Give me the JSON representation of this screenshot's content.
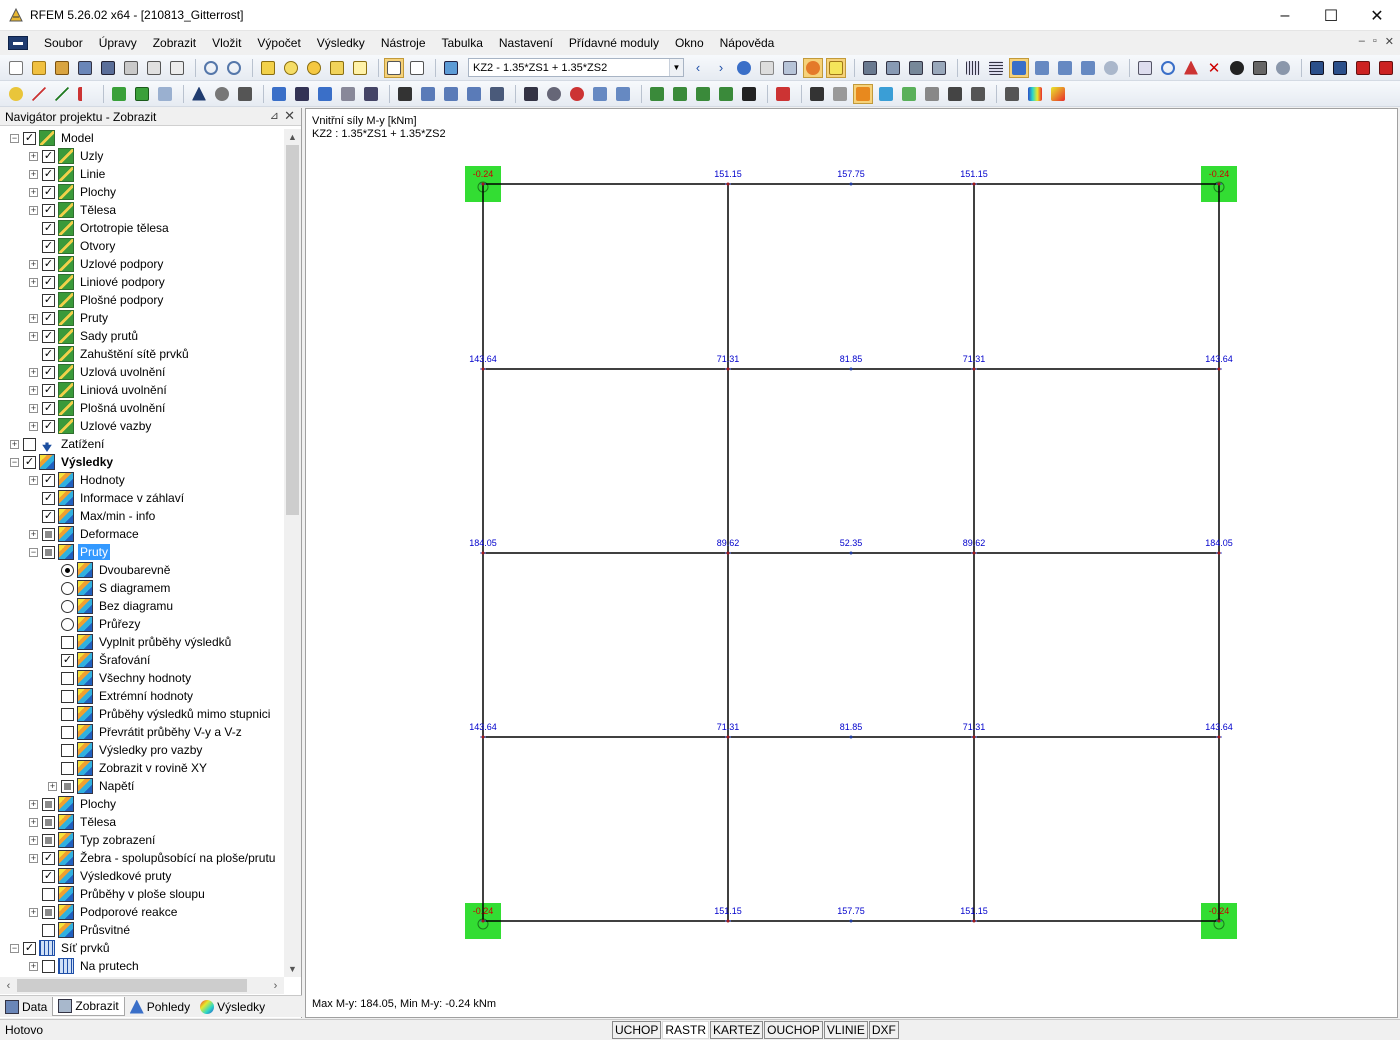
{
  "window": {
    "title": "RFEM 5.26.02 x64 - [210813_Gitterrost]",
    "controls": [
      "–",
      "☐",
      "✕"
    ]
  },
  "menu": {
    "items": [
      "Soubor",
      "Úpravy",
      "Zobrazit",
      "Vložit",
      "Výpočet",
      "Výsledky",
      "Nástroje",
      "Tabulka",
      "Nastavení",
      "Přídavné moduly",
      "Okno",
      "Nápověda"
    ],
    "mdi_controls": [
      "–",
      "▫",
      "✕"
    ]
  },
  "toolbar": {
    "load_case": "KZ2 - 1.35*ZS1 + 1.35*ZS2"
  },
  "navigator": {
    "title": "Navigátor projektu - Zobrazit",
    "pin": "⊿",
    "close": "✕",
    "tree": [
      {
        "label": "Model",
        "level": 0,
        "exp": "−",
        "check": "checked",
        "icon": "model"
      },
      {
        "label": "Uzly",
        "level": 1,
        "exp": "+",
        "check": "checked",
        "icon": "model"
      },
      {
        "label": "Linie",
        "level": 1,
        "exp": "+",
        "check": "checked",
        "icon": "model"
      },
      {
        "label": "Plochy",
        "level": 1,
        "exp": "+",
        "check": "checked",
        "icon": "model"
      },
      {
        "label": "Tělesa",
        "level": 1,
        "exp": "+",
        "check": "checked",
        "icon": "model"
      },
      {
        "label": "Ortotropie tělesa",
        "level": 1,
        "exp": "",
        "check": "checked",
        "icon": "model"
      },
      {
        "label": "Otvory",
        "level": 1,
        "exp": "",
        "check": "checked",
        "icon": "model"
      },
      {
        "label": "Uzlové podpory",
        "level": 1,
        "exp": "+",
        "check": "checked",
        "icon": "model"
      },
      {
        "label": "Liniové podpory",
        "level": 1,
        "exp": "+",
        "check": "checked",
        "icon": "model"
      },
      {
        "label": "Plošné podpory",
        "level": 1,
        "exp": "",
        "check": "checked",
        "icon": "model"
      },
      {
        "label": "Pruty",
        "level": 1,
        "exp": "+",
        "check": "checked",
        "icon": "model"
      },
      {
        "label": "Sady prutů",
        "level": 1,
        "exp": "+",
        "check": "checked",
        "icon": "model"
      },
      {
        "label": "Zahuštění sítě prvků",
        "level": 1,
        "exp": "",
        "check": "checked",
        "icon": "model"
      },
      {
        "label": "Uzlová uvolnění",
        "level": 1,
        "exp": "+",
        "check": "checked",
        "icon": "model"
      },
      {
        "label": "Liniová uvolnění",
        "level": 1,
        "exp": "+",
        "check": "checked",
        "icon": "model"
      },
      {
        "label": "Plošná uvolnění",
        "level": 1,
        "exp": "+",
        "check": "checked",
        "icon": "model"
      },
      {
        "label": "Uzlové vazby",
        "level": 1,
        "exp": "+",
        "check": "checked",
        "icon": "model"
      },
      {
        "label": "Zatížení",
        "level": 0,
        "exp": "+",
        "check": "unchecked",
        "icon": "load"
      },
      {
        "label": "Výsledky",
        "level": 0,
        "exp": "−",
        "check": "checked",
        "icon": "res",
        "bold": true
      },
      {
        "label": "Hodnoty",
        "level": 1,
        "exp": "+",
        "check": "checked",
        "icon": "res"
      },
      {
        "label": "Informace v záhlaví",
        "level": 1,
        "exp": "",
        "check": "checked",
        "icon": "res"
      },
      {
        "label": "Max/min - info",
        "level": 1,
        "exp": "",
        "check": "checked",
        "icon": "res"
      },
      {
        "label": "Deformace",
        "level": 1,
        "exp": "+",
        "check": "partial",
        "icon": "res"
      },
      {
        "label": "Pruty",
        "level": 1,
        "exp": "−",
        "check": "partial",
        "icon": "res",
        "selected": true
      },
      {
        "label": "Dvoubarevně",
        "level": 2,
        "exp": "",
        "check": "radio-on",
        "icon": "res"
      },
      {
        "label": "S diagramem",
        "level": 2,
        "exp": "",
        "check": "radio",
        "icon": "res"
      },
      {
        "label": "Bez diagramu",
        "level": 2,
        "exp": "",
        "check": "radio",
        "icon": "res"
      },
      {
        "label": "Průřezy",
        "level": 2,
        "exp": "",
        "check": "radio",
        "icon": "res"
      },
      {
        "label": "Vyplnit průběhy výsledků",
        "level": 2,
        "exp": "",
        "check": "unchecked",
        "icon": "res"
      },
      {
        "label": "Šrafování",
        "level": 2,
        "exp": "",
        "check": "checked",
        "icon": "res"
      },
      {
        "label": "Všechny hodnoty",
        "level": 2,
        "exp": "",
        "check": "unchecked",
        "icon": "res"
      },
      {
        "label": "Extrémní hodnoty",
        "level": 2,
        "exp": "",
        "check": "unchecked",
        "icon": "res"
      },
      {
        "label": "Průběhy výsledků mimo stupnici",
        "level": 2,
        "exp": "",
        "check": "unchecked",
        "icon": "res"
      },
      {
        "label": "Převrátit průběhy V-y a V-z",
        "level": 2,
        "exp": "",
        "check": "unchecked",
        "icon": "res"
      },
      {
        "label": "Výsledky pro vazby",
        "level": 2,
        "exp": "",
        "check": "unchecked",
        "icon": "res"
      },
      {
        "label": "Zobrazit v rovině XY",
        "level": 2,
        "exp": "",
        "check": "unchecked",
        "icon": "res"
      },
      {
        "label": "Napětí",
        "level": 2,
        "exp": "+",
        "check": "partial",
        "icon": "res"
      },
      {
        "label": "Plochy",
        "level": 1,
        "exp": "+",
        "check": "partial",
        "icon": "res"
      },
      {
        "label": "Tělesa",
        "level": 1,
        "exp": "+",
        "check": "partial",
        "icon": "res"
      },
      {
        "label": "Typ zobrazení",
        "level": 1,
        "exp": "+",
        "check": "partial",
        "icon": "res"
      },
      {
        "label": "Žebra - spolupůsobící na ploše/prutu",
        "level": 1,
        "exp": "+",
        "check": "checked",
        "icon": "res"
      },
      {
        "label": "Výsledkové pruty",
        "level": 1,
        "exp": "",
        "check": "checked",
        "icon": "res"
      },
      {
        "label": "Průběhy v ploše sloupu",
        "level": 1,
        "exp": "",
        "check": "unchecked",
        "icon": "res"
      },
      {
        "label": "Podporové reakce",
        "level": 1,
        "exp": "+",
        "check": "partial",
        "icon": "res"
      },
      {
        "label": "Průsvitné",
        "level": 1,
        "exp": "",
        "check": "unchecked",
        "icon": "res"
      },
      {
        "label": "Síť prvků",
        "level": 0,
        "exp": "−",
        "check": "checked",
        "icon": "mesh"
      },
      {
        "label": "Na prutech",
        "level": 1,
        "exp": "+",
        "check": "unchecked",
        "icon": "mesh"
      }
    ],
    "tabs": [
      {
        "label": "Data",
        "active": false
      },
      {
        "label": "Zobrazit",
        "active": true
      },
      {
        "label": "Pohledy",
        "active": false
      },
      {
        "label": "Výsledky",
        "active": false
      }
    ]
  },
  "workarea": {
    "result_title": "Vnitřní síly M-y [kNm]",
    "load_case": "KZ2 : 1.35*ZS1 + 1.35*ZS2",
    "maxmin": "Max M-y: 184.05, Min M-y: -0.24 kNm",
    "colors": {
      "grid_line": "#000000",
      "value_label": "#0000cc",
      "negative_label": "#cc0000",
      "support_fill": "#33dd33"
    },
    "grid_values": {
      "rows": [
        [
          "-0.24",
          "151.15",
          "157.75",
          "151.15",
          "-0.24"
        ],
        [
          "143.64",
          "71.31",
          "81.85",
          "71.31",
          "143.64"
        ],
        [
          "184.05",
          "89.62",
          "52.35",
          "89.62",
          "184.05"
        ],
        [
          "143.64",
          "71.31",
          "81.85",
          "71.31",
          "143.64"
        ],
        [
          "-0.24",
          "151.15",
          "157.75",
          "151.15",
          "-0.24"
        ]
      ]
    }
  },
  "statusbar": {
    "status": "Hotovo",
    "buttons": [
      {
        "label": "UCHOP",
        "on": false
      },
      {
        "label": "RASTR",
        "on": true
      },
      {
        "label": "KARTEZ",
        "on": false
      },
      {
        "label": "OUCHOP",
        "on": false
      },
      {
        "label": "VLINIE",
        "on": false
      },
      {
        "label": "DXF",
        "on": false
      }
    ]
  }
}
